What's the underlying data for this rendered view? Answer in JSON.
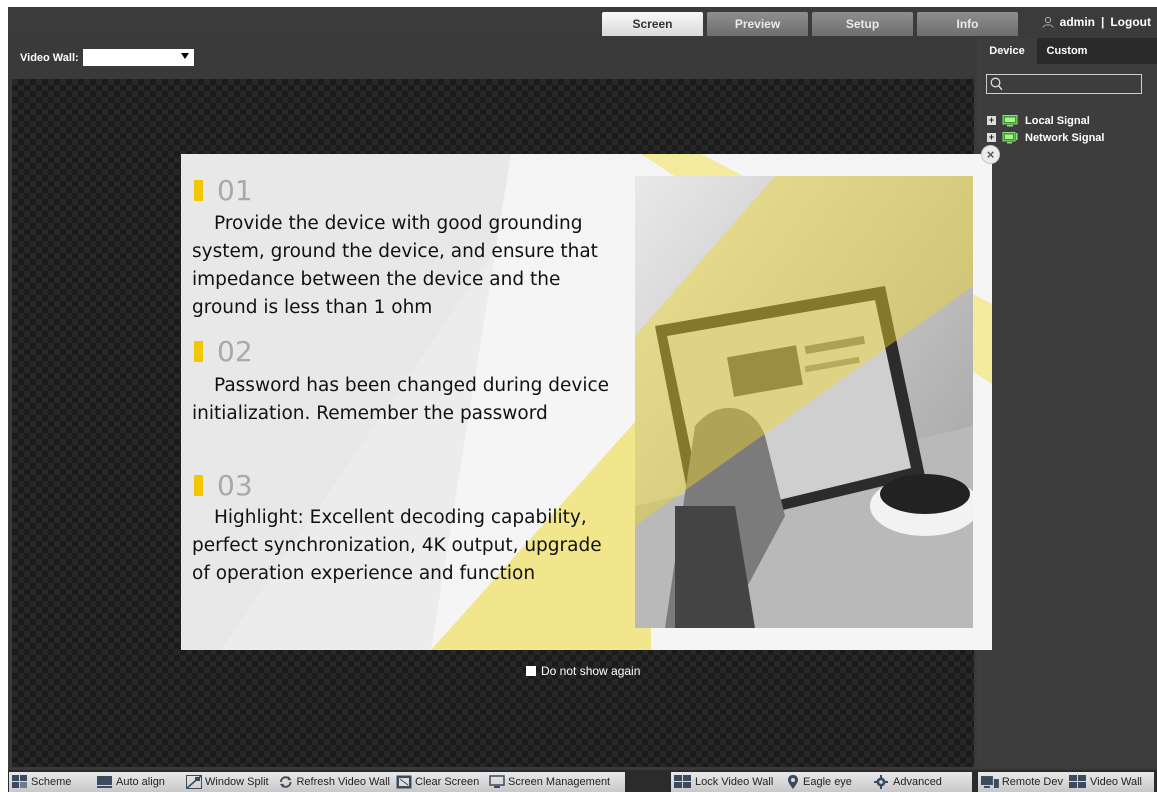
{
  "header": {
    "tabs": [
      {
        "label": "Screen",
        "active": true
      },
      {
        "label": "Preview",
        "active": false
      },
      {
        "label": "Setup",
        "active": false
      },
      {
        "label": "Info",
        "active": false
      }
    ],
    "user": "admin",
    "separator": "|",
    "logout": "Logout"
  },
  "video_wall": {
    "label": "Video Wall:",
    "selected": ""
  },
  "right_panel": {
    "tabs": [
      {
        "label": "Device",
        "active": true
      },
      {
        "label": "Custom",
        "active": false
      }
    ],
    "search_value": "",
    "tree": [
      {
        "label": "Local Signal",
        "icon": "monitor-icon"
      },
      {
        "label": "Network Signal",
        "icon": "network-monitor-icon"
      }
    ]
  },
  "modal": {
    "items": [
      {
        "number": "01",
        "text": "Provide the device with good grounding system, ground the device, and ensure that impedance between the device and the ground is less than 1 ohm"
      },
      {
        "number": "02",
        "text": "Password has been changed during device initialization. Remember the password"
      },
      {
        "number": "03",
        "text": "Highlight: Excellent decoding capability, perfect synchronization, 4K output, upgrade of operation experience and function"
      }
    ],
    "close_symbol": "×",
    "dont_show_again": "Do not show again",
    "accent_color": "#f2c600"
  },
  "toolbar_left": [
    {
      "label": "Scheme",
      "icon": "scheme-icon"
    },
    {
      "label": "Auto align",
      "icon": "auto-align-icon"
    },
    {
      "label": "Window Split",
      "icon": "window-split-icon"
    },
    {
      "label": "Refresh Video Wall",
      "icon": "refresh-icon"
    },
    {
      "label": "Clear Screen",
      "icon": "clear-screen-icon"
    },
    {
      "label": "Screen Management",
      "icon": "screen-management-icon"
    }
  ],
  "toolbar_middle": [
    {
      "label": "Lock Video Wall",
      "icon": "lock-wall-icon"
    },
    {
      "label": "Eagle eye",
      "icon": "location-pin-icon"
    },
    {
      "label": "Advanced",
      "icon": "gear-icon"
    }
  ],
  "toolbar_right": [
    {
      "label": "Remote Dev",
      "icon": "remote-device-icon"
    },
    {
      "label": "Video Wall",
      "icon": "video-wall-icon"
    }
  ]
}
